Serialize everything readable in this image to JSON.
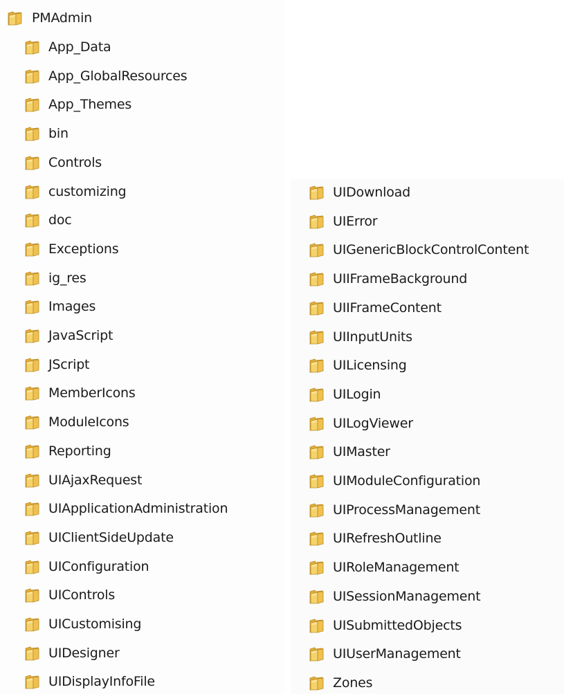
{
  "root": {
    "label": "PMAdmin",
    "icon": "folder-icon"
  },
  "left_column": [
    "App_Data",
    "App_GlobalResources",
    "App_Themes",
    "bin",
    "Controls",
    "customizing",
    "doc",
    "Exceptions",
    "ig_res",
    "Images",
    "JavaScript",
    "JScript",
    "MemberIcons",
    "ModuleIcons",
    "Reporting",
    "UIAjaxRequest",
    "UIApplicationAdministration",
    "UIClientSideUpdate",
    "UIConfiguration",
    "UIControls",
    "UICustomising",
    "UIDesigner",
    "UIDisplayInfoFile"
  ],
  "right_column": [
    "UIDownload",
    "UIError",
    "UIGenericBlockControlContent",
    "UIIFrameBackground",
    "UIIFrameContent",
    "UIInputUnits",
    "UILicensing",
    "UILogin",
    "UILogViewer",
    "UIMaster",
    "UIModuleConfiguration",
    "UIProcessManagement",
    "UIRefreshOutline",
    "UIRoleManagement",
    "UISessionManagement",
    "UISubmittedObjects",
    "UIUserManagement",
    "Zones"
  ],
  "colors": {
    "folder_front": "#f5d36c",
    "folder_back": "#e2ae3c",
    "folder_edge": "#b98a25"
  }
}
